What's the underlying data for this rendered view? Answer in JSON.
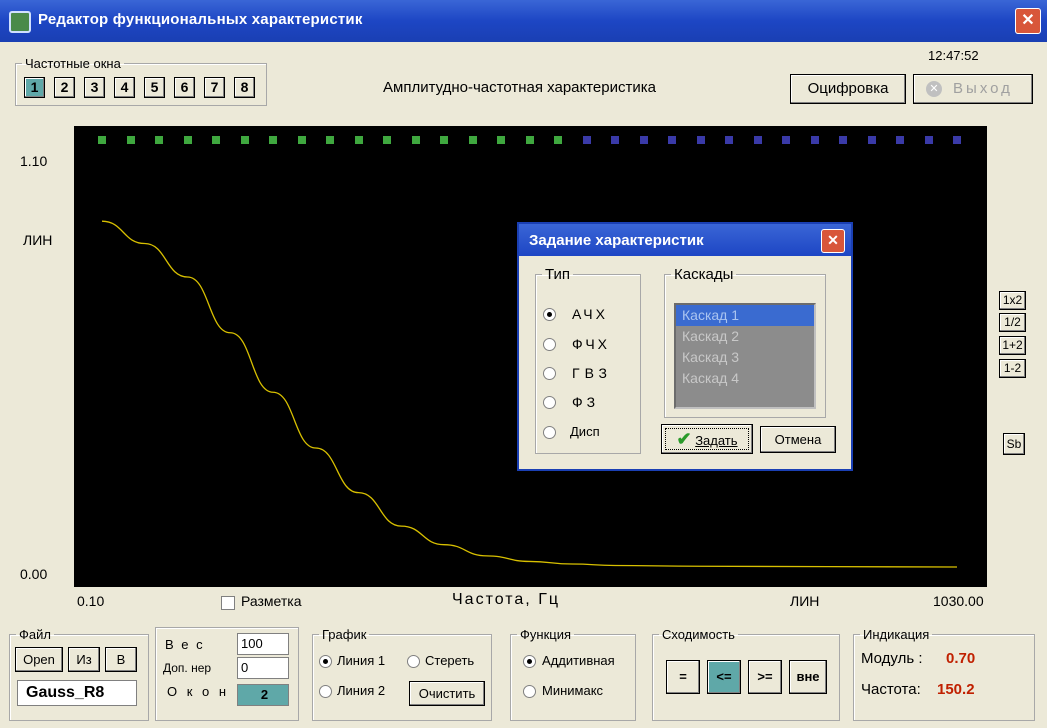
{
  "window": {
    "title": "Редактор функциональных характеристик",
    "close_label": "✕"
  },
  "clock": "12:47:52",
  "freq_windows": {
    "legend": "Частотные окна",
    "buttons": [
      "1",
      "2",
      "3",
      "4",
      "5",
      "6",
      "7",
      "8"
    ],
    "active": "1"
  },
  "chart_title": "Амплитудно-частотная характеристика",
  "toolbar": {
    "digitize_label": "Оцифровка",
    "exit_label": "Выход"
  },
  "plot": {
    "y_max_label": "1.10",
    "y_min_label": "0.00",
    "y_scale_label": "ЛИН",
    "x_min_label": "0.10",
    "x_max_label": "1030.00",
    "x_scale_label": "ЛИН",
    "x_title": "Частота, Гц",
    "grid_checkbox_label": "Разметка",
    "marker_colors": {
      "green": "#3fa83f",
      "blue": "#3a3aa8"
    },
    "markers_green_count": 17,
    "markers_blue_count": 14,
    "curve_color": "#d8c000"
  },
  "chart_data": {
    "type": "line",
    "xlabel": "Частота, Гц",
    "ylabel": "ЛИН",
    "xlim": [
      0.1,
      1030.0
    ],
    "ylim": [
      0.0,
      1.1
    ],
    "x": [
      0.1,
      51.6,
      103.1,
      154.6,
      206.1,
      257.6,
      309.1,
      360.6,
      412.1,
      463.6,
      515.1,
      566.6,
      618.1,
      720.0,
      1030.0
    ],
    "series": [
      {
        "values": [
          0.93,
          0.87,
          0.78,
          0.63,
          0.47,
          0.32,
          0.2,
          0.11,
          0.06,
          0.03,
          0.015,
          0.008,
          0.004,
          0.002,
          0.0
        ]
      }
    ]
  },
  "dialog": {
    "title": "Задание характеристик",
    "close_label": "✕",
    "type_legend": "Тип",
    "types": [
      "АЧХ",
      "ФЧХ",
      "ГВЗ",
      "ФЗ",
      "Дисп"
    ],
    "selected_type": "АЧХ",
    "cascades_legend": "Каскады",
    "cascades": [
      "Каскад 1",
      "Каскад 2",
      "Каскад 3",
      "Каскад 4"
    ],
    "selected_cascade": "Каскад 1",
    "ok_label": "Задать",
    "cancel_label": "Отмена"
  },
  "side_buttons": [
    "1x2",
    "1/2",
    "1+2",
    "1-2"
  ],
  "sb_label": "Sb",
  "file": {
    "legend": "Файл",
    "open_label": "Open",
    "from_label": "Из",
    "b_label": "В",
    "filename": "Gauss_R8"
  },
  "params": {
    "weight_label": "В е с",
    "weight_value": "100",
    "extra_label": "Доп. нер",
    "extra_value": "0",
    "windows_label": "О к о н",
    "windows_value": "2"
  },
  "graph": {
    "legend": "График",
    "line1": "Линия 1",
    "line2": "Линия 2",
    "erase": "Стереть",
    "clear": "Очистить"
  },
  "function": {
    "legend": "Функция",
    "additive": "Аддитивная",
    "minimax": "Минимакс"
  },
  "convergence": {
    "legend": "Сходимость",
    "buttons": [
      "=",
      "<=",
      ">=",
      "вне"
    ],
    "active": "<="
  },
  "indication": {
    "legend": "Индикация",
    "module_label": "Модуль :",
    "module_value": "0.70",
    "freq_label": "Частота:",
    "freq_value": "150.2",
    "value_color": "#c02000"
  }
}
